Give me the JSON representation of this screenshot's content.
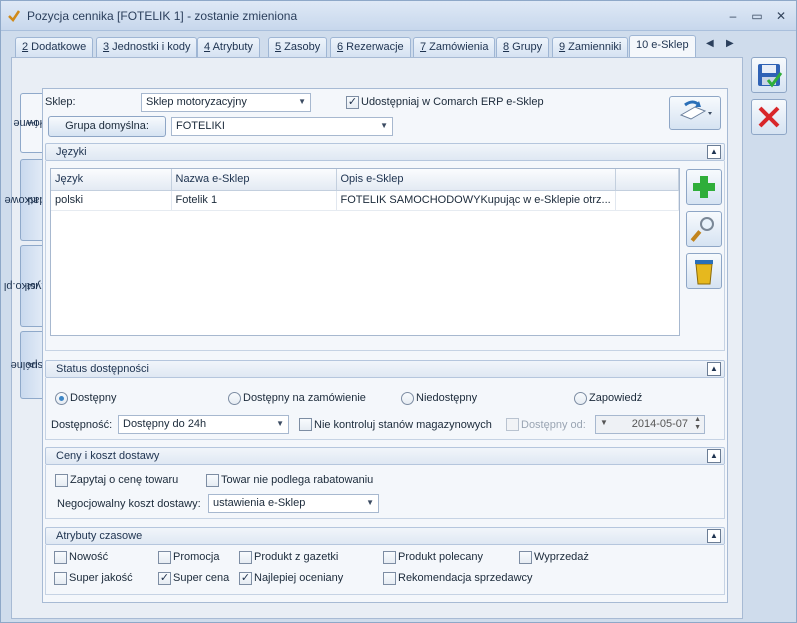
{
  "window": {
    "title": "Pozycja cennika [FOTELIK 1] - zostanie zmieniona",
    "min": "–",
    "max": "▭",
    "close": "✕"
  },
  "tabs": [
    {
      "num": "2",
      "label": " Dodatkowe"
    },
    {
      "num": "3",
      "label": " Jednostki i kody"
    },
    {
      "num": "4",
      "label": " Atrybuty"
    },
    {
      "num": "5",
      "label": " Zasoby"
    },
    {
      "num": "6",
      "label": " Rezerwacje"
    },
    {
      "num": "7",
      "label": " Zamówienia"
    },
    {
      "num": "8",
      "label": " Grupy"
    },
    {
      "num": "9",
      "label": " Zamienniki"
    },
    {
      "num": "",
      "label": "10 e-Sklep"
    }
  ],
  "vertical_tabs": [
    {
      "num": "1",
      "label": " Główne"
    },
    {
      "num": "2",
      "label": " Dodatkowe"
    },
    {
      "num": "3",
      "label": " wszystko.pl"
    },
    {
      "num": "4",
      "label": " Wspólne"
    }
  ],
  "top": {
    "shop_label": "Sklep:",
    "shop_value": "Sklep motoryzacyjny",
    "share_label": "Udostępniaj w Comarch ERP e-Sklep",
    "group_button": "Grupa domyślna:",
    "group_button_underline": "G",
    "group_value": "FOTELIKI"
  },
  "languages": {
    "title": "Języki",
    "columns": [
      "Język",
      "Nazwa e-Sklep",
      "Opis e-Sklep"
    ],
    "rows": [
      {
        "lang": "polski",
        "name": "Fotelik 1",
        "desc": "FOTELIK SAMOCHODOWYKupując w e-Sklepie otrz..."
      }
    ]
  },
  "availability": {
    "title": "Status dostępności",
    "options": [
      "Dostępny",
      "Dostępny na zamówienie",
      "Niedostępny",
      "Zapowiedź"
    ],
    "selected": 0,
    "avail_label": "Dostępność:",
    "avail_value": "Dostępny do 24h",
    "no_control_label": "Nie kontroluj stanów magazynowych",
    "from_label": "Dostępny od:",
    "from_value": "2014-05-07"
  },
  "prices": {
    "title": "Ceny i koszt dostawy",
    "ask_price": "Zapytaj o cenę towaru",
    "no_discount": "Towar nie podlega rabatowaniu",
    "shipping_label": "Negocjowalny koszt dostawy:",
    "shipping_value": "ustawienia e-Sklep"
  },
  "attributes": {
    "title": "Atrybuty czasowe",
    "items": [
      {
        "label": "Nowość",
        "checked": false
      },
      {
        "label": "Promocja",
        "checked": false
      },
      {
        "label": "Produkt z gazetki",
        "checked": false
      },
      {
        "label": "Produkt polecany",
        "checked": false
      },
      {
        "label": "Wyprzedaż",
        "checked": false
      },
      {
        "label": "Super jakość",
        "checked": false
      },
      {
        "label": "Super cena",
        "checked": true
      },
      {
        "label": "Najlepiej oceniany",
        "checked": true
      },
      {
        "label": "Rekomendacja sprzedawcy",
        "checked": false
      }
    ]
  }
}
